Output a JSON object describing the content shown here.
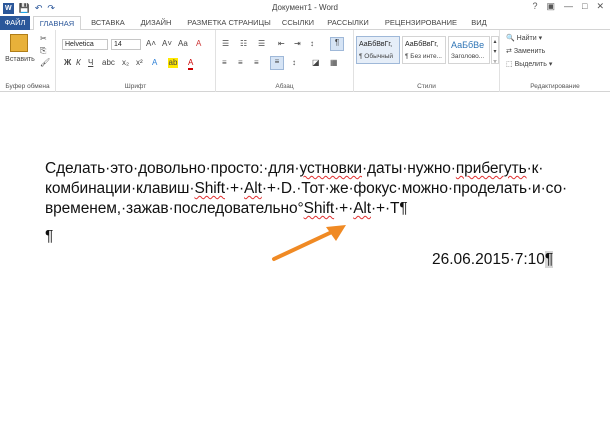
{
  "window": {
    "title": "Документ1 - Word"
  },
  "qat": {
    "save": "💾",
    "undo": "↶",
    "redo": "↷"
  },
  "tabs": {
    "file": "ФАЙЛ",
    "home": "ГЛАВНАЯ",
    "insert": "ВСТАВКА",
    "design": "ДИЗАЙН",
    "layout": "РАЗМЕТКА СТРАНИЦЫ",
    "refs": "ССЫЛКИ",
    "mail": "РАССЫЛКИ",
    "review": "РЕЦЕНЗИРОВАНИЕ",
    "view": "ВИД"
  },
  "ribbon": {
    "clipboard": {
      "paste": "Вставить",
      "label": "Буфер обмена"
    },
    "font": {
      "name": "Helvetica",
      "size": "14",
      "bold": "Ж",
      "italic": "К",
      "underline": "Ч",
      "label": "Шрифт"
    },
    "paragraph": {
      "label": "Абзац"
    },
    "styles": {
      "items": [
        {
          "preview": "АаБбВвГг,",
          "name": "¶ Обычный"
        },
        {
          "preview": "АаБбВвГг,",
          "name": "¶ Без инте..."
        },
        {
          "preview": "АаБбВе",
          "name": "Заголово..."
        }
      ],
      "label": "Стили"
    },
    "editing": {
      "find": "Найти",
      "replace": "Заменить",
      "select": "Выделить",
      "label": "Редактирование"
    }
  },
  "document": {
    "seg1": "Сделать·это·довольно·просто:·для·",
    "w1": "устновки",
    "seg2": "·даты·нужно·",
    "w2": "прибегуть",
    "seg3": "·к·",
    "seg4": "комбинации·клавиш·",
    "w3": "Shift",
    "seg5": "·+·",
    "w4": "Alt",
    "seg6": "·+·D.·Тот·же·фокус·можно·проделать·и·со·",
    "seg7": "временем,·зажав·последовательно°",
    "w5": "Shift",
    "seg8": "·+·",
    "w6": "Alt",
    "seg9": "·+·T¶",
    "empty_para": "¶",
    "date": "26.06.2015·7:10",
    "date_mark": "¶"
  },
  "colors": {
    "accent": "#2b579a",
    "arrow": "#f08a24",
    "spell": "#e03030"
  }
}
